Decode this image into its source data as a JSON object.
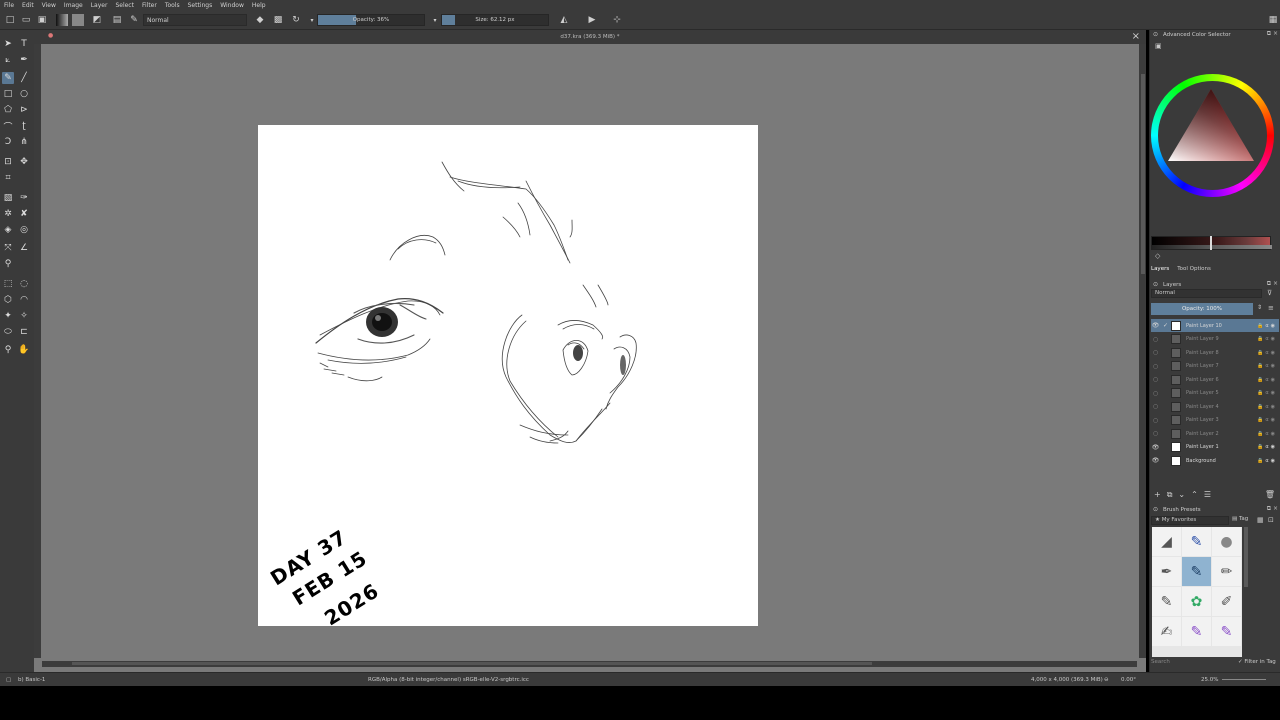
{
  "menubar": {
    "items": [
      "File",
      "Edit",
      "View",
      "Image",
      "Layer",
      "Select",
      "Filter",
      "Tools",
      "Settings",
      "Window",
      "Help"
    ]
  },
  "toolbar": {
    "blend_mode": "Normal",
    "opacity": "Opacity: 36%",
    "opacity_value": 0.36,
    "size": "Size: 62.12 px",
    "size_value": 0.12
  },
  "document": {
    "tab_title": "d37.kra (369.3 MiB) *",
    "signature_lines": [
      "DAY 37",
      "FEB 15",
      "2026"
    ]
  },
  "dock": {
    "color_selector_title": "Advanced Color Selector",
    "tabs": [
      "Layers",
      "Tool Options"
    ],
    "layers_title": "Layers",
    "layer_blend": "Normal",
    "layer_opacity": "Opacity: 100%",
    "layers": [
      {
        "name": "Paint Layer 10",
        "visible": true,
        "selected": true
      },
      {
        "name": "Paint Layer 9",
        "visible": false,
        "selected": false
      },
      {
        "name": "Paint Layer 8",
        "visible": false,
        "selected": false
      },
      {
        "name": "Paint Layer 7",
        "visible": false,
        "selected": false
      },
      {
        "name": "Paint Layer 6",
        "visible": false,
        "selected": false
      },
      {
        "name": "Paint Layer 5",
        "visible": false,
        "selected": false
      },
      {
        "name": "Paint Layer 4",
        "visible": false,
        "selected": false
      },
      {
        "name": "Paint Layer 3",
        "visible": false,
        "selected": false
      },
      {
        "name": "Paint Layer 2",
        "visible": false,
        "selected": false
      },
      {
        "name": "Paint Layer 1",
        "visible": true,
        "selected": false
      },
      {
        "name": "Background",
        "visible": true,
        "selected": false
      }
    ],
    "brush_presets_title": "Brush Presets",
    "brush_filter": "My Favorites",
    "brush_tag": "Tag",
    "brush_search_placeholder": "Search",
    "filter_in_tag": "Filter in Tag"
  },
  "statusbar": {
    "preset": "b) Basic-1",
    "color_profile": "RGB/Alpha (8-bit integer/channel)  sRGB-elle-V2-srgbtrc.icc",
    "image_size": "4,000 x 4,000 (369.3 MiB)",
    "rotation": "0.00°",
    "zoom": "25.0%"
  }
}
